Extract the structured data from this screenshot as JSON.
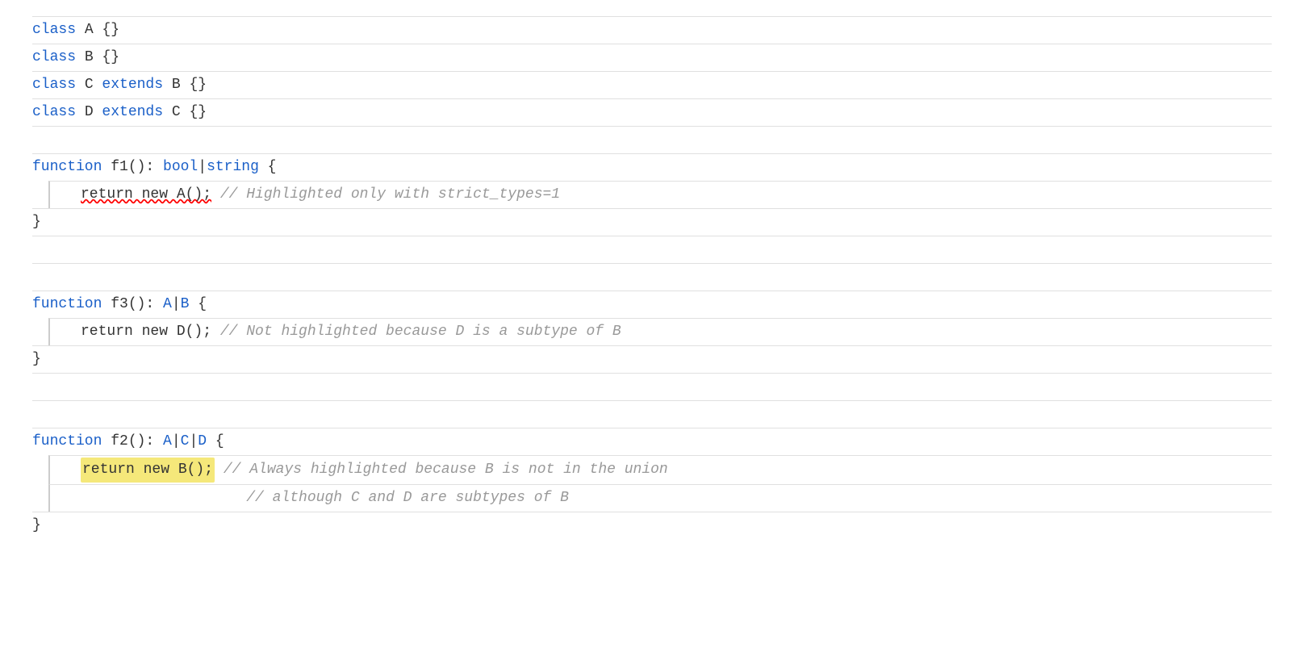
{
  "code": {
    "lines": [
      {
        "id": "class-a",
        "content": "class A {}"
      },
      {
        "id": "class-b",
        "content": "class B {}"
      },
      {
        "id": "class-c",
        "content": "class C extends B {}"
      },
      {
        "id": "class-d",
        "content": "class D extends C {}"
      },
      {
        "id": "empty1",
        "content": ""
      },
      {
        "id": "f1-sig",
        "content": "function f1(): bool|string {"
      },
      {
        "id": "f1-body",
        "content": "    return new A(); // Highlighted only with strict_types=1"
      },
      {
        "id": "f1-close",
        "content": "}"
      },
      {
        "id": "empty2",
        "content": ""
      },
      {
        "id": "empty3",
        "content": ""
      },
      {
        "id": "f3-sig",
        "content": "function f3(): A|B {"
      },
      {
        "id": "f3-body",
        "content": "    return new D(); // Not highlighted because D is a subtype of B"
      },
      {
        "id": "f3-close",
        "content": "}"
      },
      {
        "id": "empty4",
        "content": ""
      },
      {
        "id": "empty5",
        "content": ""
      },
      {
        "id": "f2-sig",
        "content": "function f2(): A|C|D {"
      },
      {
        "id": "f2-body1",
        "content": "    return new B(); // Always highlighted because B is not in the union"
      },
      {
        "id": "f2-body2",
        "content": "                   // although C and D are subtypes of B"
      },
      {
        "id": "f2-close",
        "content": "}"
      }
    ]
  }
}
